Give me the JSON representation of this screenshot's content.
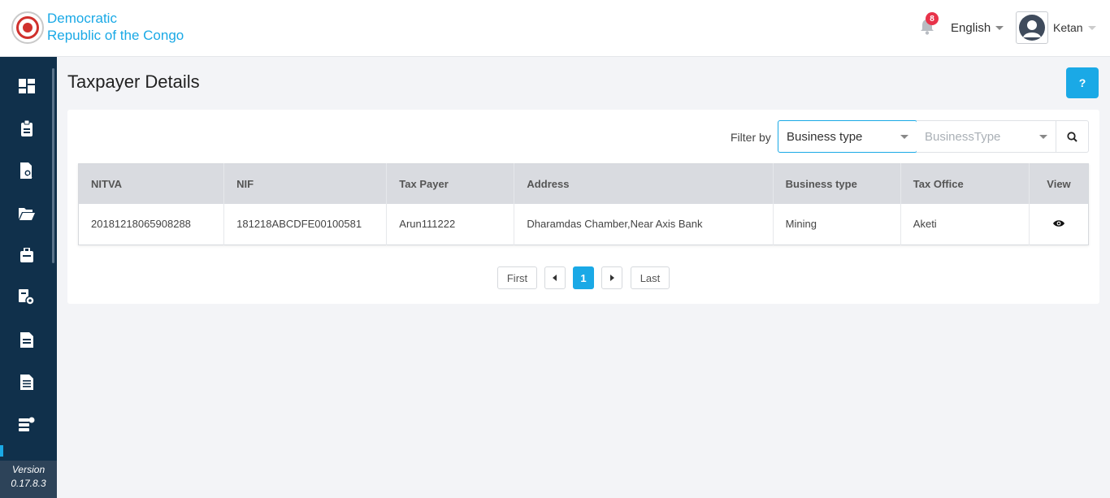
{
  "header": {
    "brand_line1": "Democratic",
    "brand_line2": "Republic of the Congo",
    "notification_count": "8",
    "language": "English",
    "user_name": "Ketan"
  },
  "sidebar": {
    "items": [
      "dashboard-icon",
      "clipboard-icon",
      "document-search-icon",
      "folder-open-icon",
      "briefcase-icon",
      "settings-user-icon",
      "report-icon",
      "report-list-icon",
      "database-settings-icon"
    ],
    "version_label": "Version",
    "version_number": "0.17.8.3"
  },
  "page": {
    "title": "Taxpayer Details",
    "help_label": "?"
  },
  "filter": {
    "label": "Filter by",
    "selected": "Business type",
    "value_placeholder": "BusinessType"
  },
  "table": {
    "columns": [
      "NITVA",
      "NIF",
      "Tax Payer",
      "Address",
      "Business type",
      "Tax Office",
      "View"
    ],
    "rows": [
      {
        "nitva": "20181218065908288",
        "nif": "181218ABCDFE00100581",
        "tax_payer": "Arun111222",
        "address": "Dharamdas Chamber,Near Axis Bank",
        "business_type": "Mining",
        "tax_office": "Aketi"
      }
    ]
  },
  "pagination": {
    "first": "First",
    "current": "1",
    "last": "Last"
  },
  "colors": {
    "accent": "#1aa9e6",
    "sidebar": "#10304b",
    "badge": "#e8334a"
  }
}
